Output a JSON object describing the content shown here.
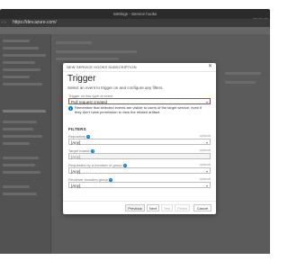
{
  "window": {
    "title": "Settings - Service hooks",
    "url": "https://dev.azure.com/",
    "nav_glyph": "‹ ›"
  },
  "dialog": {
    "header": "NEW SERVICE HOOKS SUBSCRIPTION",
    "close_glyph": "✕",
    "title": "Trigger",
    "subtitle": "Select an event to trigger on and configure any filters.",
    "event_label": "Trigger on this type of event",
    "event_value": "Pull request created",
    "info_text": "Remember that selected events are visible to users of the target service, even if they don't have permission to view the related artifact.",
    "filters_heading": "FILTERS",
    "filters": [
      {
        "label": "Repository",
        "optional": "optional",
        "value": "[Any]",
        "disabled": false
      },
      {
        "label": "Target branch",
        "optional": "optional",
        "value": "[Any]",
        "disabled": true
      },
      {
        "label": "Requested by a member of group",
        "optional": "optional",
        "value": "[Any]",
        "disabled": false
      },
      {
        "label": "Reviewer includes group",
        "optional": "optional",
        "value": "[Any]",
        "disabled": false
      }
    ],
    "buttons": {
      "previous": "Previous",
      "next": "Next",
      "test": "Test",
      "finish": "Finish",
      "cancel": "Cancel"
    }
  },
  "colors": {
    "error_border": "#d83b2f",
    "accent": "#0078d4"
  }
}
